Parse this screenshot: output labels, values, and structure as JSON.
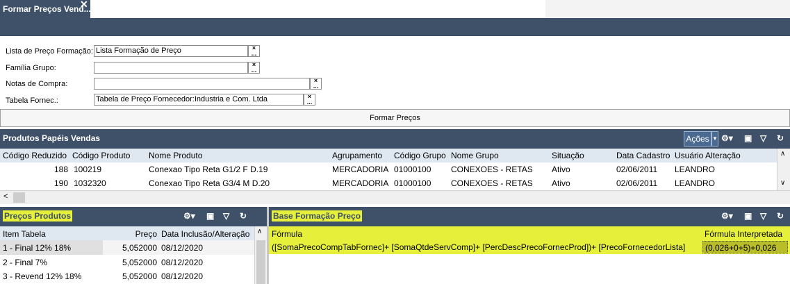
{
  "tab": {
    "title": "Formar Preços Vend...",
    "close": "✕"
  },
  "form": {
    "lista_label": "Lista de Preço Formação:",
    "lista_value": "Lista Formação de Preço",
    "familia_label": "Família Grupo:",
    "familia_value": "",
    "notas_label": "Notas de Compra:",
    "notas_value": "",
    "tabela_label": "Tabela Fornec.:",
    "tabela_value": "Tabela de Preço Fornecedor:Industria e Com. Ltda",
    "clear_glyph": "×",
    "lookup_glyph": "...",
    "formar_button": "Formar Preços"
  },
  "produtos": {
    "title": "Produtos Papéis Vendas",
    "acoes": "Ações",
    "columns": [
      "Código Reduzido",
      "Código Produto",
      "Nome Produto",
      "Agrupamento",
      "Código Grupo",
      "Nome Grupo",
      "Situação",
      "Data Cadastro",
      "Usuário Alteração"
    ],
    "rows": [
      [
        "188",
        "100219",
        "Conexao Tipo Reta G1/2 F D.19",
        "MERCADORIA",
        "01000100",
        "CONEXOES - RETAS",
        "Ativo",
        "02/06/2011",
        "LEANDRO"
      ],
      [
        "190",
        "1032320",
        "Conexao Tipo Reta G3/4 M D.20",
        "MERCADORIA",
        "01000100",
        "CONEXOES - RETAS",
        "Ativo",
        "02/06/2011",
        "LEANDRO"
      ]
    ]
  },
  "precos": {
    "title": "Preços Produtos",
    "columns": [
      "Item Tabela",
      "Preço",
      "Data Inclusão/Alteração"
    ],
    "rows": [
      [
        "1 - Final 12% 18%",
        "5,052000",
        "08/12/2020"
      ],
      [
        "2 - Final 7%",
        "5,052000",
        "08/12/2020"
      ],
      [
        "3 - Revend 12% 18%",
        "5,052000",
        "08/12/2020"
      ]
    ]
  },
  "base": {
    "title": "Base Formação Preço",
    "col_formula": "Fórmula",
    "col_interpretada": "Fórmula Interpretada",
    "formula": "([SomaPrecoCompTabFornec]+ [SomaQtdeServComp]+ [PercDescPrecoFornecProd])+ [PrecoFornecedorLista]",
    "interpretada": "(0,026+0+5)+0,026"
  },
  "icons": {
    "tool_settings": "settings-dropdown-icon",
    "tool_export": "export-icon",
    "tool_filter": "filter-icon",
    "tool_refresh": "refresh-icon",
    "scroll_left": "chevron-left-icon",
    "scroll_up": "chevron-up-icon",
    "scroll_down": "chevron-down-icon"
  },
  "colors": {
    "header": "#3f5168",
    "column_header": "#dfe7f0",
    "highlight": "#e6f03a"
  }
}
